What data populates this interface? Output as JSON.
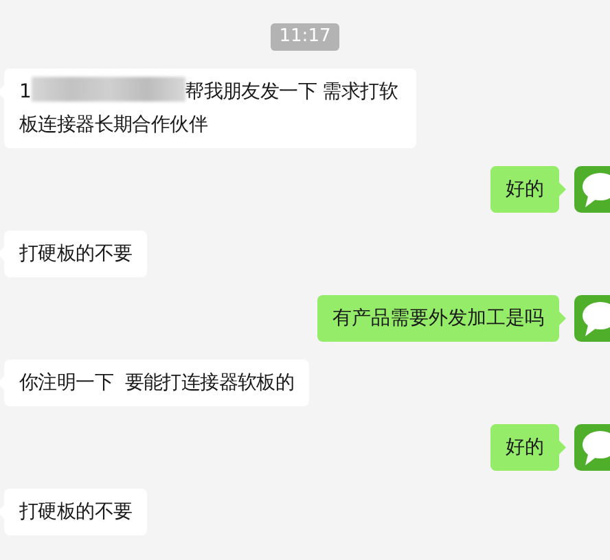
{
  "time_label": "11:17",
  "messages": [
    {
      "kind": "incoming",
      "text_before": "1",
      "redacted": true,
      "text": "帮我朋友发一下 需求打软板连接器长期合作伙伴"
    },
    {
      "kind": "outgoing",
      "text": "好的"
    },
    {
      "kind": "incoming",
      "text": "打硬板的不要"
    },
    {
      "kind": "outgoing",
      "text": "有产品需要外发加工是吗"
    },
    {
      "kind": "incoming",
      "text": "你注明一下  要能打连接器软板的"
    },
    {
      "kind": "outgoing",
      "text": "好的"
    },
    {
      "kind": "incoming",
      "text": "打硬板的不要"
    }
  ]
}
